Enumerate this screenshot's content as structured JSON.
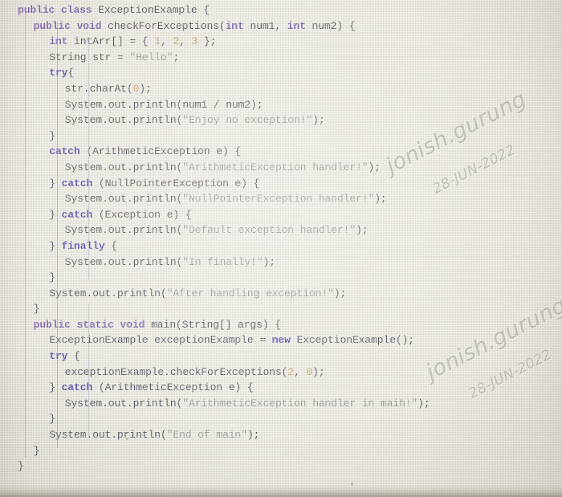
{
  "app": {
    "type": "code-editor-photo",
    "language": "Java",
    "class_name": "ExceptionExample"
  },
  "colors": {
    "background": "#efece4",
    "keyword": "#6d51a8",
    "keyword_control": "#3b35a6",
    "string": "#8e8e92",
    "number": "#c89a52",
    "identifier": "#3a3f4a",
    "indent_guide": "#828ca5",
    "watermark": "#787670"
  },
  "watermarks": [
    {
      "name": "jonish.gurung",
      "date": "28-JUN-2022"
    },
    {
      "name": "jonish.gurung",
      "date": "28-JUN-2022"
    }
  ],
  "code": {
    "lines": [
      {
        "indent": 0,
        "tokens": [
          {
            "t": "public",
            "c": "kw"
          },
          {
            "t": " ",
            "c": "pn"
          },
          {
            "t": "class",
            "c": "kw"
          },
          {
            "t": " ",
            "c": "pn"
          },
          {
            "t": "ExceptionExample",
            "c": "id"
          },
          {
            "t": " {",
            "c": "pn"
          }
        ]
      },
      {
        "indent": 1,
        "tokens": [
          {
            "t": "public",
            "c": "kw"
          },
          {
            "t": " ",
            "c": "pn"
          },
          {
            "t": "void",
            "c": "kw"
          },
          {
            "t": " ",
            "c": "pn"
          },
          {
            "t": "checkForExceptions(",
            "c": "id"
          },
          {
            "t": "int",
            "c": "kw"
          },
          {
            "t": " num1, ",
            "c": "id"
          },
          {
            "t": "int",
            "c": "kw"
          },
          {
            "t": " num2) {",
            "c": "id"
          }
        ]
      },
      {
        "indent": 2,
        "tokens": [
          {
            "t": "int",
            "c": "kw"
          },
          {
            "t": " intArr[] = { ",
            "c": "id"
          },
          {
            "t": "1",
            "c": "num"
          },
          {
            "t": ", ",
            "c": "id"
          },
          {
            "t": "2",
            "c": "num"
          },
          {
            "t": ", ",
            "c": "id"
          },
          {
            "t": "3",
            "c": "num"
          },
          {
            "t": " };",
            "c": "id"
          }
        ]
      },
      {
        "indent": 2,
        "tokens": [
          {
            "t": "String str = ",
            "c": "id"
          },
          {
            "t": "\"Hello\"",
            "c": "str"
          },
          {
            "t": ";",
            "c": "id"
          }
        ]
      },
      {
        "indent": 2,
        "tokens": [
          {
            "t": "try",
            "c": "kw2"
          },
          {
            "t": "{",
            "c": "id"
          }
        ]
      },
      {
        "indent": 3,
        "tokens": [
          {
            "t": "str.charAt(",
            "c": "id"
          },
          {
            "t": "0",
            "c": "num"
          },
          {
            "t": ");",
            "c": "id"
          }
        ]
      },
      {
        "indent": 3,
        "tokens": [
          {
            "t": "System.out.println(num1 / num2);",
            "c": "id"
          }
        ]
      },
      {
        "indent": 3,
        "tokens": [
          {
            "t": "System.out.println(",
            "c": "id"
          },
          {
            "t": "\"Enjoy no exception!\"",
            "c": "str"
          },
          {
            "t": ");",
            "c": "id"
          }
        ]
      },
      {
        "indent": 2,
        "tokens": [
          {
            "t": "}",
            "c": "id"
          }
        ]
      },
      {
        "indent": 2,
        "tokens": [
          {
            "t": "catch",
            "c": "kw2"
          },
          {
            "t": " (ArithmeticException e) {",
            "c": "id"
          }
        ]
      },
      {
        "indent": 3,
        "tokens": [
          {
            "t": "System.out.println(",
            "c": "id"
          },
          {
            "t": "\"ArithmeticException handler!\"",
            "c": "str"
          },
          {
            "t": ");",
            "c": "id"
          }
        ]
      },
      {
        "indent": 2,
        "tokens": [
          {
            "t": "} ",
            "c": "id"
          },
          {
            "t": "catch",
            "c": "kw2"
          },
          {
            "t": " (NullPointerException e) {",
            "c": "id"
          }
        ]
      },
      {
        "indent": 3,
        "tokens": [
          {
            "t": "System.out.println(",
            "c": "id"
          },
          {
            "t": "\"NullPointerException handler!\"",
            "c": "str"
          },
          {
            "t": ");",
            "c": "id"
          }
        ]
      },
      {
        "indent": 2,
        "tokens": [
          {
            "t": "} ",
            "c": "id"
          },
          {
            "t": "catch",
            "c": "kw2"
          },
          {
            "t": " (Exception e) {",
            "c": "id"
          }
        ]
      },
      {
        "indent": 3,
        "tokens": [
          {
            "t": "System.out.println(",
            "c": "id"
          },
          {
            "t": "\"Default exception handler!\"",
            "c": "str"
          },
          {
            "t": ");",
            "c": "id"
          }
        ]
      },
      {
        "indent": 2,
        "tokens": [
          {
            "t": "} ",
            "c": "id"
          },
          {
            "t": "finally",
            "c": "kw2"
          },
          {
            "t": " {",
            "c": "id"
          }
        ]
      },
      {
        "indent": 3,
        "tokens": [
          {
            "t": "System.out.println(",
            "c": "id"
          },
          {
            "t": "\"In finally!\"",
            "c": "str"
          },
          {
            "t": ");",
            "c": "id"
          }
        ]
      },
      {
        "indent": 2,
        "tokens": [
          {
            "t": "}",
            "c": "id"
          }
        ]
      },
      {
        "indent": 2,
        "tokens": [
          {
            "t": "System.out.println(",
            "c": "id"
          },
          {
            "t": "\"After handling exception!\"",
            "c": "str"
          },
          {
            "t": ");",
            "c": "id"
          }
        ]
      },
      {
        "indent": 1,
        "tokens": [
          {
            "t": "}",
            "c": "id"
          }
        ]
      },
      {
        "indent": 1,
        "tokens": [
          {
            "t": "public",
            "c": "kw"
          },
          {
            "t": " ",
            "c": "pn"
          },
          {
            "t": "static",
            "c": "kw"
          },
          {
            "t": " ",
            "c": "pn"
          },
          {
            "t": "void",
            "c": "kw"
          },
          {
            "t": " main(String[] args) {",
            "c": "id"
          }
        ]
      },
      {
        "indent": 2,
        "tokens": [
          {
            "t": "ExceptionExample exceptionExample = ",
            "c": "id"
          },
          {
            "t": "new",
            "c": "kw2"
          },
          {
            "t": " ExceptionExample();",
            "c": "id"
          }
        ]
      },
      {
        "indent": 2,
        "tokens": [
          {
            "t": "try",
            "c": "kw2"
          },
          {
            "t": " {",
            "c": "id"
          }
        ]
      },
      {
        "indent": 3,
        "tokens": [
          {
            "t": "exceptionExample.checkForExceptions(",
            "c": "id"
          },
          {
            "t": "2",
            "c": "num"
          },
          {
            "t": ", ",
            "c": "id"
          },
          {
            "t": "0",
            "c": "num"
          },
          {
            "t": ");",
            "c": "id"
          }
        ]
      },
      {
        "indent": 2,
        "tokens": [
          {
            "t": "} ",
            "c": "id"
          },
          {
            "t": "catch",
            "c": "kw2"
          },
          {
            "t": " (ArithmeticException e) {",
            "c": "id"
          }
        ]
      },
      {
        "indent": 3,
        "tokens": [
          {
            "t": "System.out.println(",
            "c": "id"
          },
          {
            "t": "\"ArithmeticException handler in main!\"",
            "c": "str"
          },
          {
            "t": ");",
            "c": "id"
          }
        ]
      },
      {
        "indent": 2,
        "tokens": [
          {
            "t": "}",
            "c": "id"
          }
        ]
      },
      {
        "indent": 2,
        "tokens": [
          {
            "t": "System.out.println(",
            "c": "id"
          },
          {
            "t": "\"End of main\"",
            "c": "str"
          },
          {
            "t": ");",
            "c": "id"
          }
        ]
      },
      {
        "indent": 1,
        "tokens": [
          {
            "t": "}",
            "c": "id"
          }
        ]
      },
      {
        "indent": 0,
        "tokens": [
          {
            "t": "}",
            "c": "id"
          }
        ]
      }
    ]
  }
}
